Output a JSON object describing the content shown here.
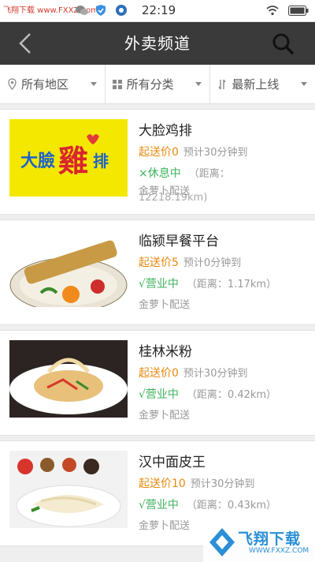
{
  "status_bar": {
    "watermark": "飞翔下载 www.FXXZ.com",
    "time": "22:19",
    "icons": [
      "wechat-icon",
      "camera-icon",
      "mail-icon",
      "shield-icon",
      "app-icon",
      "wifi-icon",
      "battery-icon"
    ]
  },
  "nav": {
    "title": "外卖频道",
    "back_icon": "chevron-left-icon",
    "search_icon": "search-icon"
  },
  "filters": [
    {
      "label": "所有地区",
      "icon": "location-pin-icon"
    },
    {
      "label": "所有分类",
      "icon": "grid-icon"
    },
    {
      "label": "最新上线",
      "icon": "sort-icon"
    }
  ],
  "shops": [
    {
      "name": "大脸鸡排",
      "min_order": "起送价0",
      "eta": "预计30分钟到",
      "status": "×休息中",
      "distance": "（距离：",
      "distance2": "12218.19km)",
      "delivery": "金萝卜配送",
      "thumb_logo_text": "大臉雞排"
    },
    {
      "name": "临颍早餐平台",
      "min_order": "起送价5",
      "eta": "预计0分钟到",
      "status": "√营业中",
      "distance": "（距离：1.17km）",
      "delivery": "金萝卜配送"
    },
    {
      "name": "桂林米粉",
      "min_order": "起送价0",
      "eta": "预计30分钟到",
      "status": "√营业中",
      "distance": "（距离：0.42km）",
      "delivery": "金萝卜配送"
    },
    {
      "name": "汉中面皮王",
      "min_order": "起送价10",
      "eta": "预计30分钟到",
      "status": "√营业中",
      "distance": "（距离：0.43km）",
      "delivery": "金萝卜配送"
    }
  ],
  "overlay": {
    "text": "飞翔下载",
    "url": "WWW.FXXZ.COM"
  },
  "colors": {
    "nav_bg": "#3a3a3a",
    "price_orange": "#e8890e",
    "status_green": "#3cb35c"
  }
}
